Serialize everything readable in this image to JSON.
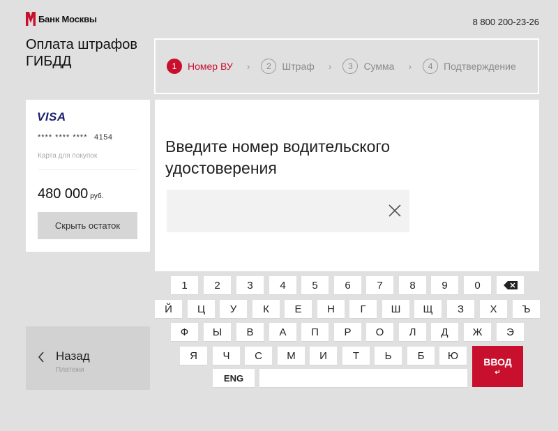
{
  "header": {
    "bank_name": "Банк Москвы",
    "phone": "8 800 200-23-26"
  },
  "page": {
    "title": "Оплата штрафов ГИБДД"
  },
  "steps": [
    {
      "num": "1",
      "label": "Номер ВУ",
      "active": true
    },
    {
      "num": "2",
      "label": "Штраф",
      "active": false
    },
    {
      "num": "3",
      "label": "Сумма",
      "active": false
    },
    {
      "num": "4",
      "label": "Подтверждение",
      "active": false
    }
  ],
  "card": {
    "brand": "VISA",
    "number_mask": "**** **** ****",
    "last4": "4154",
    "subtitle": "Карта для покупок",
    "balance": "480 000",
    "currency": "руб.",
    "hide_label": "Скрыть остаток"
  },
  "main": {
    "prompt": "Введите номер водительского удостоверения",
    "input_value": ""
  },
  "back": {
    "label": "Назад",
    "subtitle": "Платежи"
  },
  "keyboard": {
    "row1": [
      "1",
      "2",
      "3",
      "4",
      "5",
      "6",
      "7",
      "8",
      "9",
      "0"
    ],
    "row2": [
      "Й",
      "Ц",
      "У",
      "К",
      "Е",
      "Н",
      "Г",
      "Ш",
      "Щ",
      "З",
      "Х",
      "Ъ"
    ],
    "row3": [
      "Ф",
      "Ы",
      "В",
      "А",
      "П",
      "Р",
      "О",
      "Л",
      "Д",
      "Ж",
      "Э"
    ],
    "row4": [
      "Я",
      "Ч",
      "С",
      "М",
      "И",
      "Т",
      "Ь",
      "Б",
      "Ю"
    ],
    "lang": "ENG",
    "enter_label": "ВВОД",
    "enter_glyph": "↵"
  },
  "colors": {
    "accent": "#c8102e",
    "background": "#e0e0e0"
  }
}
